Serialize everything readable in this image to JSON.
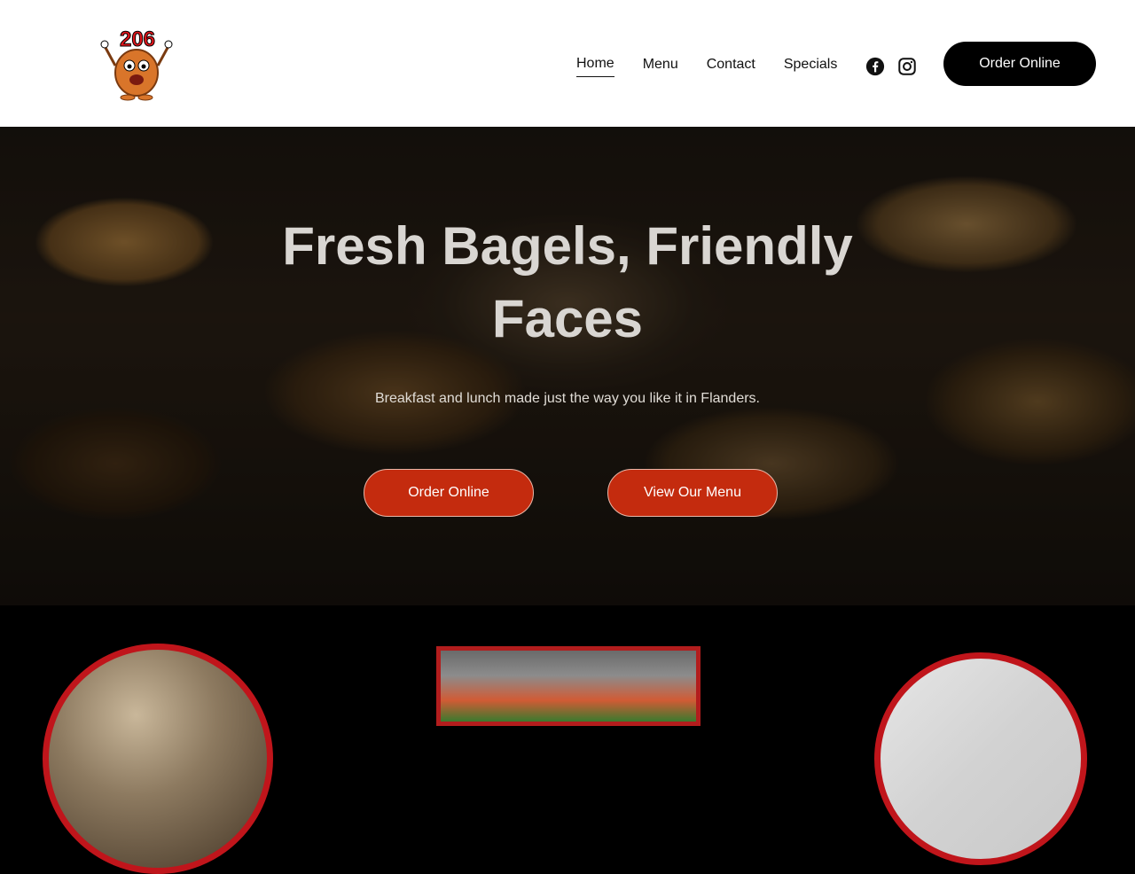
{
  "brand": {
    "logo_text": "206"
  },
  "nav": {
    "items": [
      {
        "label": "Home",
        "active": true
      },
      {
        "label": "Menu",
        "active": false
      },
      {
        "label": "Contact",
        "active": false
      },
      {
        "label": "Specials",
        "active": false
      }
    ],
    "social": [
      "facebook-icon",
      "instagram-icon"
    ],
    "order_button": "Order Online"
  },
  "hero": {
    "title": "Fresh Bagels, Friendly Faces",
    "subtitle": "Breakfast and lunch made just the way you like it in Flanders.",
    "buttons": {
      "order": "Order Online",
      "menu": "View Our Menu"
    }
  },
  "colors": {
    "accent": "#c42b0e",
    "header_bg": "#ffffff",
    "order_button_bg": "#000000",
    "card_border": "#c0151b"
  }
}
